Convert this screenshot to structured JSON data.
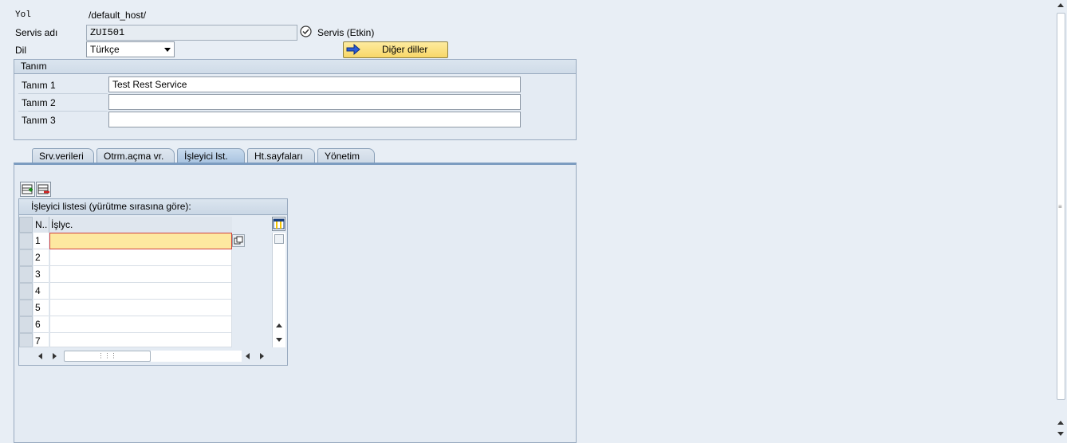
{
  "header": {
    "yol_label": "Yol",
    "yol_value": "/default_host/",
    "servis_label": "Servis adı",
    "servis_value": "ZUI501",
    "servis_status": "Servis (Etkin)",
    "dil_label": "Dil",
    "dil_value": "Türkçe",
    "other_languages_button": "Diğer diller"
  },
  "tanim": {
    "title": "Tanım",
    "rows": [
      {
        "label": "Tanım 1",
        "value": "Test Rest Service"
      },
      {
        "label": "Tanım 2",
        "value": ""
      },
      {
        "label": "Tanım 3",
        "value": ""
      }
    ]
  },
  "tabs": [
    {
      "label": "Srv.verileri",
      "active": false
    },
    {
      "label": "Otrm.açma vr.",
      "active": false
    },
    {
      "label": "İşleyici lst.",
      "active": true
    },
    {
      "label": "Ht.sayfaları",
      "active": false
    },
    {
      "label": "Yönetim",
      "active": false
    }
  ],
  "handler_table": {
    "title": "İşleyici listesi (yürütme sırasına göre):",
    "col_num": "N..",
    "col_handler": "İşlyc.",
    "rows": [
      "1",
      "2",
      "3",
      "4",
      "5",
      "6",
      "7"
    ]
  },
  "colors": {
    "background": "#e8eef5",
    "selected_cell": "#fde8a0",
    "button_yellow": "#f8d768",
    "active_tab": "#a8c3e0"
  }
}
